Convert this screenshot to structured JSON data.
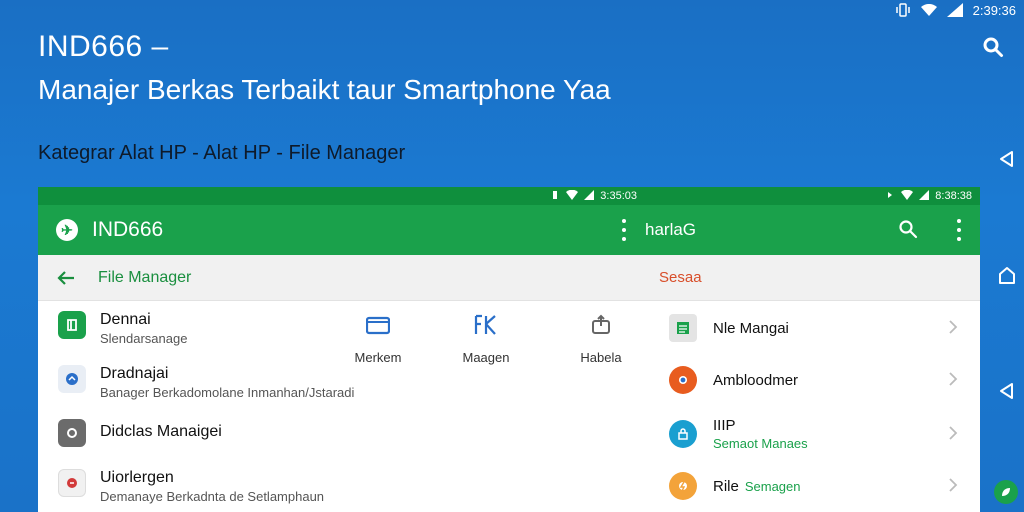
{
  "status": {
    "time": "2:39:36"
  },
  "hero": {
    "title": "IND666 –",
    "subtitle": "Manajer Berkas Terbaikt taur Smartphone Yaa",
    "category": "Kategrar Alat HP - Alat HP - File Manager"
  },
  "left_panel": {
    "status_time": "3:35:03",
    "app_title": "IND666",
    "sub_title": "File Manager",
    "items": [
      {
        "title": "Dennai",
        "sub": "Slendarsanage",
        "icon": "file-icon",
        "color": "#1aa14b"
      },
      {
        "title": "Dradnajai",
        "sub": "Banager Berkadomolane Inmanhan/Jstaradi",
        "icon": "bird-icon",
        "color": "#e9eef5"
      },
      {
        "title": "Didclas Manaigei",
        "sub": "",
        "icon": "shield-icon",
        "color": "#6b6b6b"
      },
      {
        "title": "Uiorlergen",
        "sub": "Demanaye Berkadnta de Setlamphaun",
        "icon": "app-icon",
        "color": "#f1f1f1"
      }
    ],
    "shortcuts": [
      {
        "label": "Merkem",
        "icon": "folder-icon"
      },
      {
        "label": "Maagen",
        "icon": "tool-icon"
      },
      {
        "label": "Habela",
        "icon": "upload-icon"
      }
    ]
  },
  "right_panel": {
    "status_time": "8:38:38",
    "app_title": "harlaG",
    "sub_title": "Sesaa",
    "items": [
      {
        "title": "Nle Mangai",
        "sub": "",
        "icon": "doc-icon",
        "color": "#e4e4e4"
      },
      {
        "title": "Ambloodmer",
        "sub": "",
        "icon": "record-icon",
        "color": "#e85c1f"
      },
      {
        "title": "IIIP",
        "sub": "Semaot Manaes",
        "icon": "lock-icon",
        "color": "#1a9fd0"
      },
      {
        "title": "Rile",
        "sub": "Semagen",
        "icon": "bolt-icon",
        "color": "#f3a33a"
      }
    ]
  },
  "colors": {
    "accent": "#1aa14b",
    "status_green": "#0f8f3d",
    "background": "#1a6fc4"
  }
}
